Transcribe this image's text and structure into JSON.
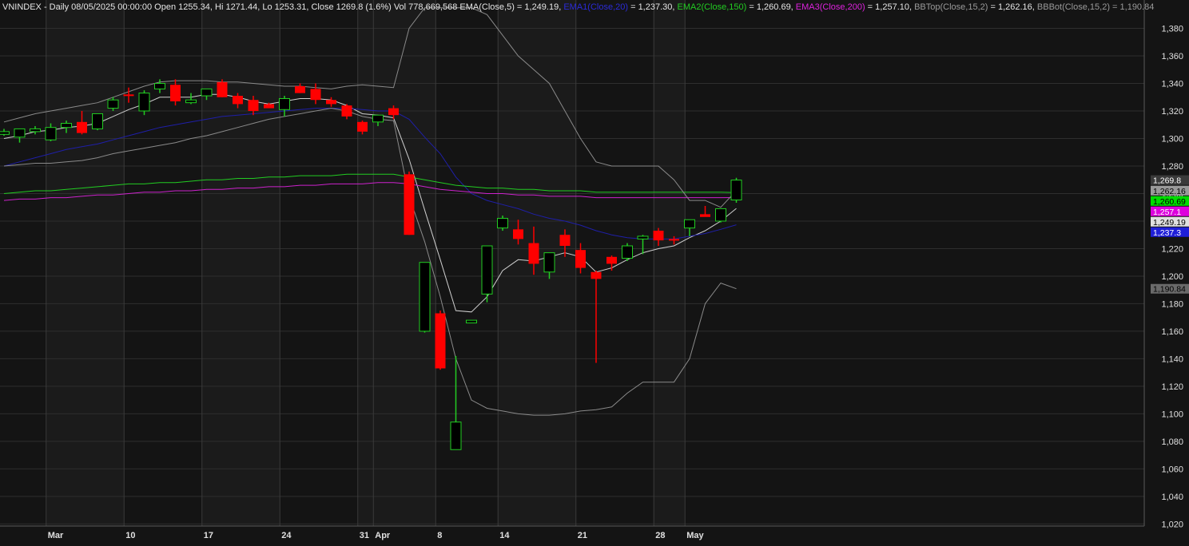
{
  "header": {
    "segments": [
      {
        "text": "VNINDEX - Daily 08/05/2025 00:00:00 Open 1255.34, Hi 1271.44, Lo 1253.31, Close 1269.8 (1.6%) Vol 778,669,568 EMA(Close,5) = 1,249.19, ",
        "color": "#e6e6e6"
      },
      {
        "text": "EMA1(Close,20)",
        "color": "#2b2bd8"
      },
      {
        "text": " = 1,237.30, ",
        "color": "#e6e6e6"
      },
      {
        "text": "EMA2(Close,150)",
        "color": "#22cc22"
      },
      {
        "text": " = 1,260.69, ",
        "color": "#e6e6e6"
      },
      {
        "text": "EMA3(Close,200)",
        "color": "#dd22dd"
      },
      {
        "text": " = 1,257.10, ",
        "color": "#e6e6e6"
      },
      {
        "text": "BBTop(Close,15,2)",
        "color": "#9a9a9a"
      },
      {
        "text": " = 1,262.16, ",
        "color": "#e6e6e6"
      },
      {
        "text": "BBBot(Close,15,2) = 1,190.84",
        "color": "#9a9a9a"
      }
    ]
  },
  "chart_data": {
    "type": "candlestick",
    "symbol": "VNINDEX",
    "ylim": [
      1010,
      1390
    ],
    "yticks": [
      "1,020",
      "1,040",
      "1,060",
      "1,080",
      "1,100",
      "1,120",
      "1,140",
      "1,160",
      "1,180",
      "1,200",
      "1,220",
      "1,240",
      "1,260",
      "1,280",
      "1,300",
      "1,320",
      "1,340",
      "1,360",
      "1,380"
    ],
    "ytick_values": [
      1020,
      1040,
      1060,
      1080,
      1100,
      1120,
      1140,
      1160,
      1180,
      1200,
      1220,
      1240,
      1260,
      1280,
      1300,
      1320,
      1340,
      1360,
      1380
    ],
    "xlabels": [
      {
        "label": "Mar",
        "bar": 3
      },
      {
        "label": "10",
        "bar": 8
      },
      {
        "label": "17",
        "bar": 13
      },
      {
        "label": "24",
        "bar": 18
      },
      {
        "label": "31",
        "bar": 23
      },
      {
        "label": "Apr",
        "bar": 24
      },
      {
        "label": "8",
        "bar": 28
      },
      {
        "label": "14",
        "bar": 32
      },
      {
        "label": "21",
        "bar": 37
      },
      {
        "label": "28",
        "bar": 42
      },
      {
        "label": "May",
        "bar": 44
      }
    ],
    "bars": [
      {
        "o": 1303,
        "h": 1307,
        "l": 1302,
        "c": 1305
      },
      {
        "o": 1301,
        "h": 1307,
        "l": 1297,
        "c": 1307
      },
      {
        "o": 1305,
        "h": 1309,
        "l": 1303,
        "c": 1307
      },
      {
        "o": 1299,
        "h": 1311,
        "l": 1298,
        "c": 1308
      },
      {
        "o": 1308,
        "h": 1313,
        "l": 1304,
        "c": 1311
      },
      {
        "o": 1312,
        "h": 1320,
        "l": 1303,
        "c": 1304
      },
      {
        "o": 1307,
        "h": 1318,
        "l": 1306,
        "c": 1318
      },
      {
        "o": 1322,
        "h": 1330,
        "l": 1320,
        "c": 1328
      },
      {
        "o": 1332,
        "h": 1337,
        "l": 1326,
        "c": 1331
      },
      {
        "o": 1320,
        "h": 1335,
        "l": 1317,
        "c": 1333
      },
      {
        "o": 1336,
        "h": 1343,
        "l": 1333,
        "c": 1340
      },
      {
        "o": 1339,
        "h": 1343,
        "l": 1324,
        "c": 1327
      },
      {
        "o": 1326,
        "h": 1333,
        "l": 1325,
        "c": 1328
      },
      {
        "o": 1331,
        "h": 1336,
        "l": 1328,
        "c": 1336
      },
      {
        "o": 1341,
        "h": 1343,
        "l": 1330,
        "c": 1330
      },
      {
        "o": 1331,
        "h": 1333,
        "l": 1322,
        "c": 1325
      },
      {
        "o": 1328,
        "h": 1331,
        "l": 1317,
        "c": 1320
      },
      {
        "o": 1325,
        "h": 1326,
        "l": 1322,
        "c": 1322
      },
      {
        "o": 1321,
        "h": 1331,
        "l": 1316,
        "c": 1329
      },
      {
        "o": 1338,
        "h": 1340,
        "l": 1333,
        "c": 1333
      },
      {
        "o": 1336,
        "h": 1340,
        "l": 1325,
        "c": 1328
      },
      {
        "o": 1328,
        "h": 1330,
        "l": 1323,
        "c": 1325
      },
      {
        "o": 1324,
        "h": 1325,
        "l": 1314,
        "c": 1316
      },
      {
        "o": 1312,
        "h": 1313,
        "l": 1303,
        "c": 1305
      },
      {
        "o": 1312,
        "h": 1315,
        "l": 1309,
        "c": 1317
      },
      {
        "o": 1322,
        "h": 1324,
        "l": 1314,
        "c": 1317
      },
      {
        "o": 1274,
        "h": 1276,
        "l": 1230,
        "c": 1230
      },
      {
        "o": 1160,
        "h": 1210,
        "l": 1159,
        "c": 1210
      },
      {
        "o": 1173,
        "h": 1175,
        "l": 1132,
        "c": 1133
      },
      {
        "o": 1074,
        "h": 1142,
        "l": 1074,
        "c": 1094
      },
      {
        "o": 1166,
        "h": 1168,
        "l": 1166,
        "c": 1168
      },
      {
        "o": 1187,
        "h": 1222,
        "l": 1181,
        "c": 1222
      },
      {
        "o": 1235,
        "h": 1244,
        "l": 1233,
        "c": 1242
      },
      {
        "o": 1234,
        "h": 1241,
        "l": 1223,
        "c": 1227
      },
      {
        "o": 1224,
        "h": 1236,
        "l": 1201,
        "c": 1209
      },
      {
        "o": 1203,
        "h": 1217,
        "l": 1198,
        "c": 1217
      },
      {
        "o": 1230,
        "h": 1234,
        "l": 1214,
        "c": 1222
      },
      {
        "o": 1219,
        "h": 1224,
        "l": 1202,
        "c": 1206
      },
      {
        "o": 1203,
        "h": 1204,
        "l": 1137,
        "c": 1198
      },
      {
        "o": 1214,
        "h": 1215,
        "l": 1204,
        "c": 1209
      },
      {
        "o": 1213,
        "h": 1224,
        "l": 1211,
        "c": 1222
      },
      {
        "o": 1227,
        "h": 1230,
        "l": 1216,
        "c": 1229
      },
      {
        "o": 1233,
        "h": 1235,
        "l": 1222,
        "c": 1226
      },
      {
        "o": 1227,
        "h": 1229,
        "l": 1223,
        "c": 1226
      },
      {
        "o": 1235,
        "h": 1241,
        "l": 1229,
        "c": 1241
      },
      {
        "o": 1245,
        "h": 1251,
        "l": 1244,
        "c": 1243
      },
      {
        "o": 1240,
        "h": 1249,
        "l": 1239,
        "c": 1249
      },
      {
        "o": 1255.34,
        "h": 1271.44,
        "l": 1253.31,
        "c": 1269.8
      }
    ],
    "series": [
      {
        "name": "EMA(Close,5)",
        "color": "#cfcfcf",
        "values": [
          1300,
          1302,
          1305,
          1306,
          1308,
          1309,
          1311,
          1316,
          1321,
          1325,
          1330,
          1330,
          1330,
          1332,
          1332,
          1330,
          1327,
          1325,
          1327,
          1329,
          1329,
          1328,
          1324,
          1318,
          1317,
          1315,
          1285,
          1248,
          1212,
          1175,
          1174,
          1185,
          1204,
          1212,
          1211,
          1214,
          1217,
          1214,
          1203,
          1206,
          1212,
          1217,
          1220,
          1222,
          1228,
          1233,
          1240,
          1249.19
        ]
      },
      {
        "name": "EMA1(Close,20)",
        "color": "#1f1fa8",
        "values": [
          1280,
          1283,
          1286,
          1289,
          1292,
          1294,
          1296,
          1299,
          1302,
          1305,
          1308,
          1310,
          1312,
          1314,
          1316,
          1317,
          1318,
          1319,
          1320,
          1321,
          1322,
          1322,
          1322,
          1321,
          1320,
          1320,
          1314,
          1301,
          1289,
          1272,
          1260,
          1255,
          1252,
          1249,
          1245,
          1242,
          1240,
          1237,
          1233,
          1230,
          1228,
          1227,
          1227,
          1227,
          1229,
          1231,
          1234,
          1237.3
        ]
      },
      {
        "name": "EMA2(Close,150)",
        "color": "#22cc22",
        "values": [
          1260,
          1261,
          1262,
          1262,
          1263,
          1264,
          1265,
          1266,
          1267,
          1267,
          1268,
          1268,
          1269,
          1270,
          1270,
          1271,
          1271,
          1272,
          1272,
          1273,
          1273,
          1273,
          1274,
          1274,
          1274,
          1274,
          1272,
          1270,
          1268,
          1266,
          1265,
          1264,
          1264,
          1263,
          1263,
          1262,
          1262,
          1262,
          1261,
          1261,
          1261,
          1261,
          1261,
          1261,
          1261,
          1261,
          1261,
          1260.69
        ]
      },
      {
        "name": "EMA3(Close,200)",
        "color": "#cc22cc",
        "values": [
          1255,
          1256,
          1256,
          1257,
          1257,
          1258,
          1259,
          1259,
          1260,
          1261,
          1261,
          1262,
          1262,
          1263,
          1263,
          1264,
          1264,
          1265,
          1265,
          1266,
          1266,
          1267,
          1267,
          1267,
          1268,
          1268,
          1267,
          1265,
          1263,
          1262,
          1261,
          1260,
          1260,
          1259,
          1259,
          1258,
          1258,
          1258,
          1257,
          1257,
          1257,
          1257,
          1257,
          1257,
          1257,
          1257,
          1257,
          1257.1
        ]
      },
      {
        "name": "BBTop(Close,15,2)",
        "color": "#8a8a8a",
        "values": [
          1312,
          1315,
          1318,
          1320,
          1322,
          1324,
          1326,
          1330,
          1334,
          1338,
          1341,
          1342,
          1342,
          1342,
          1341,
          1341,
          1340,
          1339,
          1338,
          1338,
          1337,
          1336,
          1338,
          1339,
          1338,
          1337,
          1380,
          1395,
          1395,
          1395,
          1395,
          1390,
          1375,
          1360,
          1350,
          1340,
          1320,
          1300,
          1283,
          1280,
          1280,
          1280,
          1280,
          1270,
          1255,
          1255,
          1250,
          1262.16
        ]
      },
      {
        "name": "BBBot(Close,15,2)",
        "color": "#8a8a8a",
        "values": [
          1280,
          1281,
          1282,
          1282,
          1283,
          1284,
          1286,
          1289,
          1291,
          1293,
          1295,
          1297,
          1300,
          1302,
          1305,
          1308,
          1311,
          1314,
          1316,
          1318,
          1320,
          1322,
          1320,
          1316,
          1314,
          1313,
          1258,
          1225,
          1185,
          1140,
          1110,
          1104,
          1102,
          1100,
          1099,
          1099,
          1100,
          1102,
          1103,
          1105,
          1115,
          1123,
          1123,
          1123,
          1140,
          1180,
          1195,
          1190.84
        ]
      }
    ],
    "price_tags": [
      {
        "label": "1,269.8",
        "value": 1269.8,
        "bg": "#3a3a3a",
        "fg": "#ffffff"
      },
      {
        "label": "1,262.16",
        "value": 1262.16,
        "bg": "#9a9a9a",
        "fg": "#000000"
      },
      {
        "label": "1,260.69",
        "value": 1260.69,
        "bg": "#00dd00",
        "fg": "#000000"
      },
      {
        "label": "1,257.1",
        "value": 1257.1,
        "bg": "#dd00dd",
        "fg": "#ffffff"
      },
      {
        "label": "1,249.19",
        "value": 1249.19,
        "bg": "#e0e0e0",
        "fg": "#000000"
      },
      {
        "label": "1,237.3",
        "value": 1237.3,
        "bg": "#1f1fd8",
        "fg": "#ffffff"
      },
      {
        "label": "1,190.84",
        "value": 1190.84,
        "bg": "#6a6a6a",
        "fg": "#000000"
      }
    ],
    "colors": {
      "up": "#22cc22",
      "down": "#ff0000",
      "background": "#141414",
      "grid": "#2e2e2e",
      "axis_text": "#e0e0e0"
    },
    "grid": true
  }
}
